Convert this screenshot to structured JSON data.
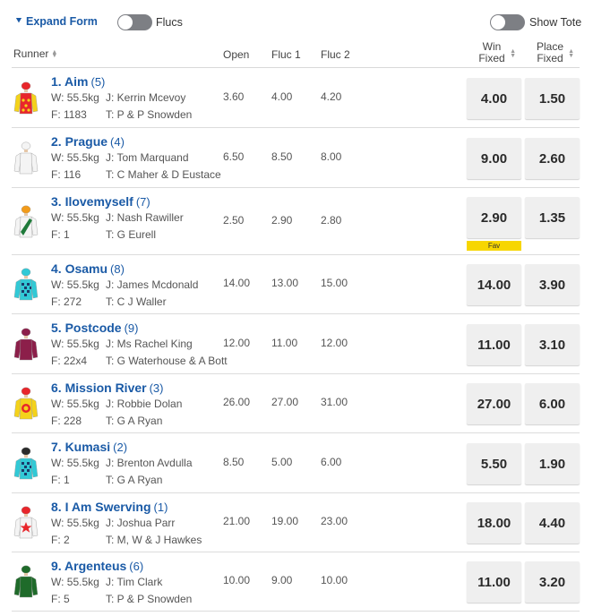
{
  "toolbar": {
    "expand_label": "Expand Form",
    "flucs_label": "Flucs",
    "show_tote_label": "Show Tote"
  },
  "columns": {
    "runner": "Runner",
    "open": "Open",
    "fluc1": "Fluc 1",
    "fluc2": "Fluc 2",
    "win_line1": "Win",
    "win_line2": "Fixed",
    "place_line1": "Place",
    "place_line2": "Fixed"
  },
  "runners": [
    {
      "name": "1. Aim",
      "barrier": "(5)",
      "weight": "W: 55.5kg",
      "jockey": "J: Kerrin Mcevoy",
      "form": "F: 1183",
      "trainer": "T: P & P Snowden",
      "open": "3.60",
      "fluc1": "4.00",
      "fluc2": "4.20",
      "win": "4.00",
      "place": "1.50",
      "fav": "",
      "silk": "red-yellow-stars"
    },
    {
      "name": "2. Prague",
      "barrier": "(4)",
      "weight": "W: 55.5kg",
      "jockey": "J: Tom Marquand",
      "form": "F: 116",
      "trainer": "T: C Maher & D Eustace",
      "open": "6.50",
      "fluc1": "8.50",
      "fluc2": "8.00",
      "win": "9.00",
      "place": "2.60",
      "fav": "",
      "silk": "white"
    },
    {
      "name": "3. Ilovemyself",
      "barrier": "(7)",
      "weight": "W: 55.5kg",
      "jockey": "J: Nash Rawiller",
      "form": "F: 1",
      "trainer": "T: G Eurell",
      "open": "2.50",
      "fluc1": "2.90",
      "fluc2": "2.80",
      "win": "2.90",
      "place": "1.35",
      "fav": "Fav",
      "silk": "white-green-sash"
    },
    {
      "name": "4. Osamu",
      "barrier": "(8)",
      "weight": "W: 55.5kg",
      "jockey": "J: James Mcdonald",
      "form": "F: 272",
      "trainer": "T: C J Waller",
      "open": "14.00",
      "fluc1": "13.00",
      "fluc2": "15.00",
      "win": "14.00",
      "place": "3.90",
      "fav": "",
      "silk": "aqua-checks"
    },
    {
      "name": "5. Postcode",
      "barrier": "(9)",
      "weight": "W: 55.5kg",
      "jockey": "J: Ms Rachel King",
      "form": "F: 22x4",
      "trainer": "T: G Waterhouse & A Bott",
      "open": "12.00",
      "fluc1": "11.00",
      "fluc2": "12.00",
      "win": "11.00",
      "place": "3.10",
      "fav": "",
      "silk": "maroon"
    },
    {
      "name": "6. Mission River",
      "barrier": "(3)",
      "weight": "W: 55.5kg",
      "jockey": "J: Robbie Dolan",
      "form": "F: 228",
      "trainer": "T: G A Ryan",
      "open": "26.00",
      "fluc1": "27.00",
      "fluc2": "31.00",
      "win": "27.00",
      "place": "6.00",
      "fav": "",
      "silk": "yellow-red-target"
    },
    {
      "name": "7. Kumasi",
      "barrier": "(2)",
      "weight": "W: 55.5kg",
      "jockey": "J: Brenton Avdulla",
      "form": "F: 1",
      "trainer": "T: G A Ryan",
      "open": "8.50",
      "fluc1": "5.00",
      "fluc2": "6.00",
      "win": "5.50",
      "place": "1.90",
      "fav": "",
      "silk": "aqua-checks-dark-cap"
    },
    {
      "name": "8. I Am Swerving",
      "barrier": "(1)",
      "weight": "W: 55.5kg",
      "jockey": "J: Joshua Parr",
      "form": "F: 2",
      "trainer": "T: M, W & J Hawkes",
      "open": "21.00",
      "fluc1": "19.00",
      "fluc2": "23.00",
      "win": "18.00",
      "place": "4.40",
      "fav": "",
      "silk": "white-red-star"
    },
    {
      "name": "9. Argenteus",
      "barrier": "(6)",
      "weight": "W: 55.5kg",
      "jockey": "J: Tim Clark",
      "form": "F: 5",
      "trainer": "T: P & P Snowden",
      "open": "10.00",
      "fluc1": "9.00",
      "fluc2": "10.00",
      "win": "11.00",
      "place": "3.20",
      "fav": "",
      "silk": "green"
    }
  ],
  "colors": {
    "link": "#1a5aa6",
    "toggle_off": "#7d7f84",
    "odds_button": "#efefef",
    "fav_badge": "#f7d600"
  }
}
